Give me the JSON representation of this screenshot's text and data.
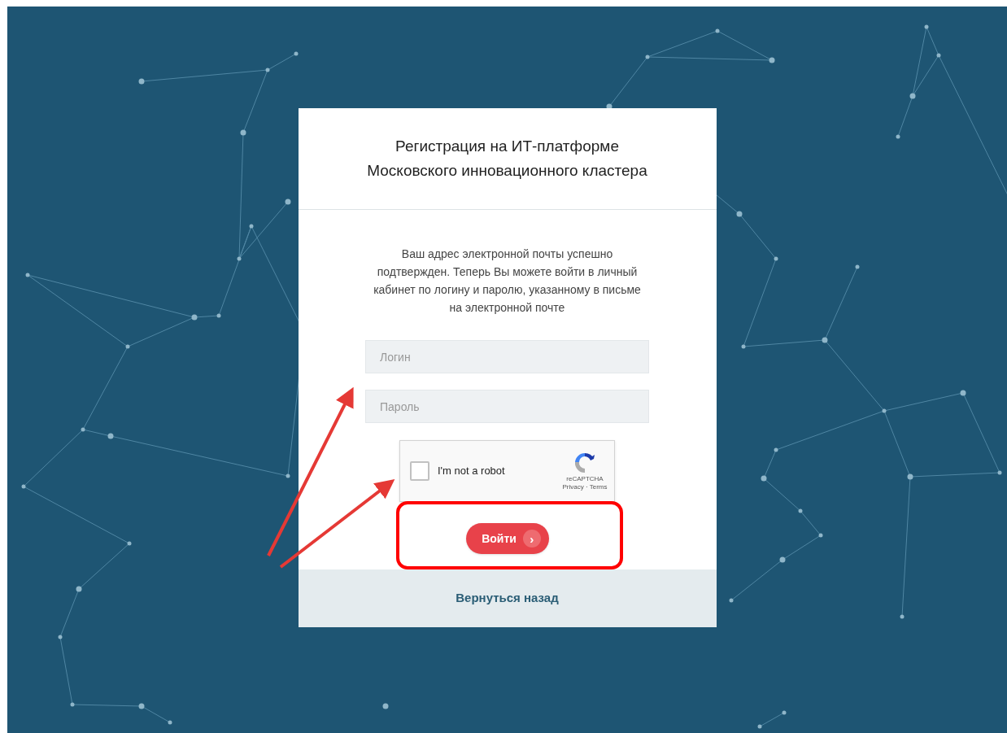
{
  "card": {
    "title_lines": [
      "Регистрация на ИТ-платформе",
      "Московского инновационного кластера"
    ],
    "message_lines": [
      "Ваш адрес электронной почты успешно",
      "подтвержден. Теперь Вы можете войти в личный",
      "кабинет по логину и паролю, указанному в письме",
      "на электронной почте"
    ],
    "fields": [
      {
        "placeholder": "Логин"
      },
      {
        "placeholder": "Пароль"
      }
    ],
    "captcha": {
      "label": "I'm not a robot",
      "checked": false,
      "brand": "reCAPTCHA",
      "links": "Privacy · Terms"
    },
    "submit": {
      "label": "Войти",
      "chevron": "›"
    },
    "back_link": "Вернуться назад"
  }
}
